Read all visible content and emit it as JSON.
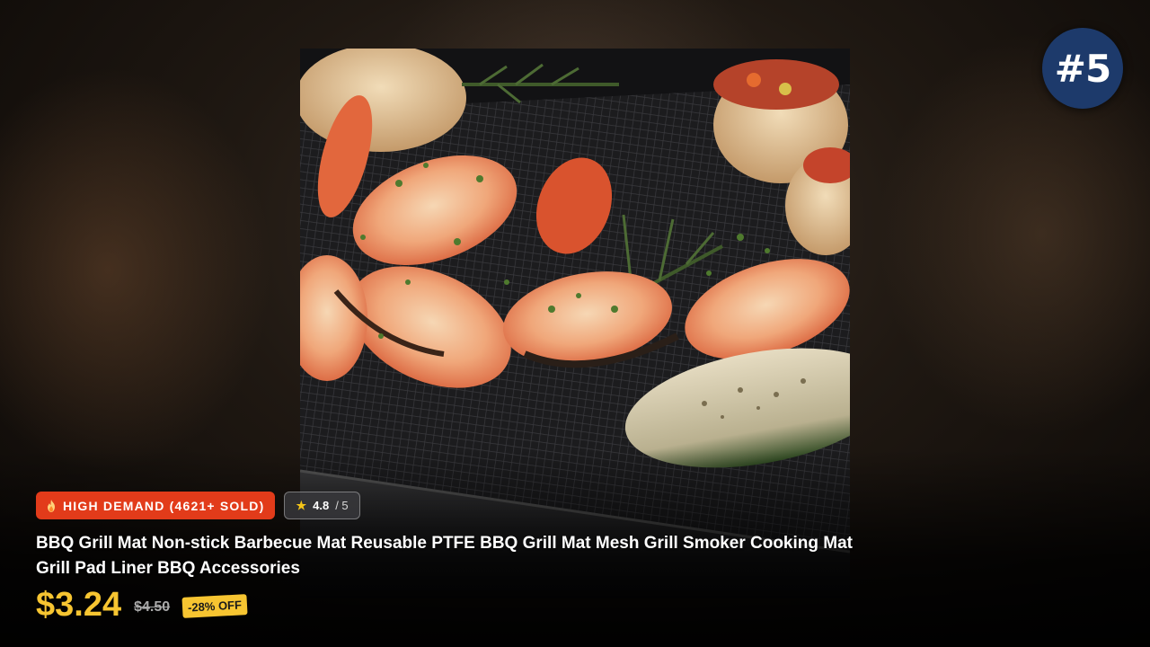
{
  "rank": "#5",
  "product": {
    "demand_icon": "fire-icon",
    "demand_label": "HIGH DEMAND (4621+ SOLD)",
    "rating_icon": "star-icon",
    "rating_value": "4.8",
    "rating_max": "/ 5",
    "title": "BBQ Grill Mat Non-stick Barbecue Mat Reusable PTFE BBQ Grill Mat Mesh Grill Smoker Cooking Mat Grill Pad Liner BBQ Accessories",
    "price": "$3.24",
    "old_price": "$4.50",
    "discount": "-28% OFF"
  },
  "colors": {
    "accent_price": "#f7c531",
    "demand_badge": "#e23b1a",
    "rank_badge": "#1d3a6b"
  }
}
